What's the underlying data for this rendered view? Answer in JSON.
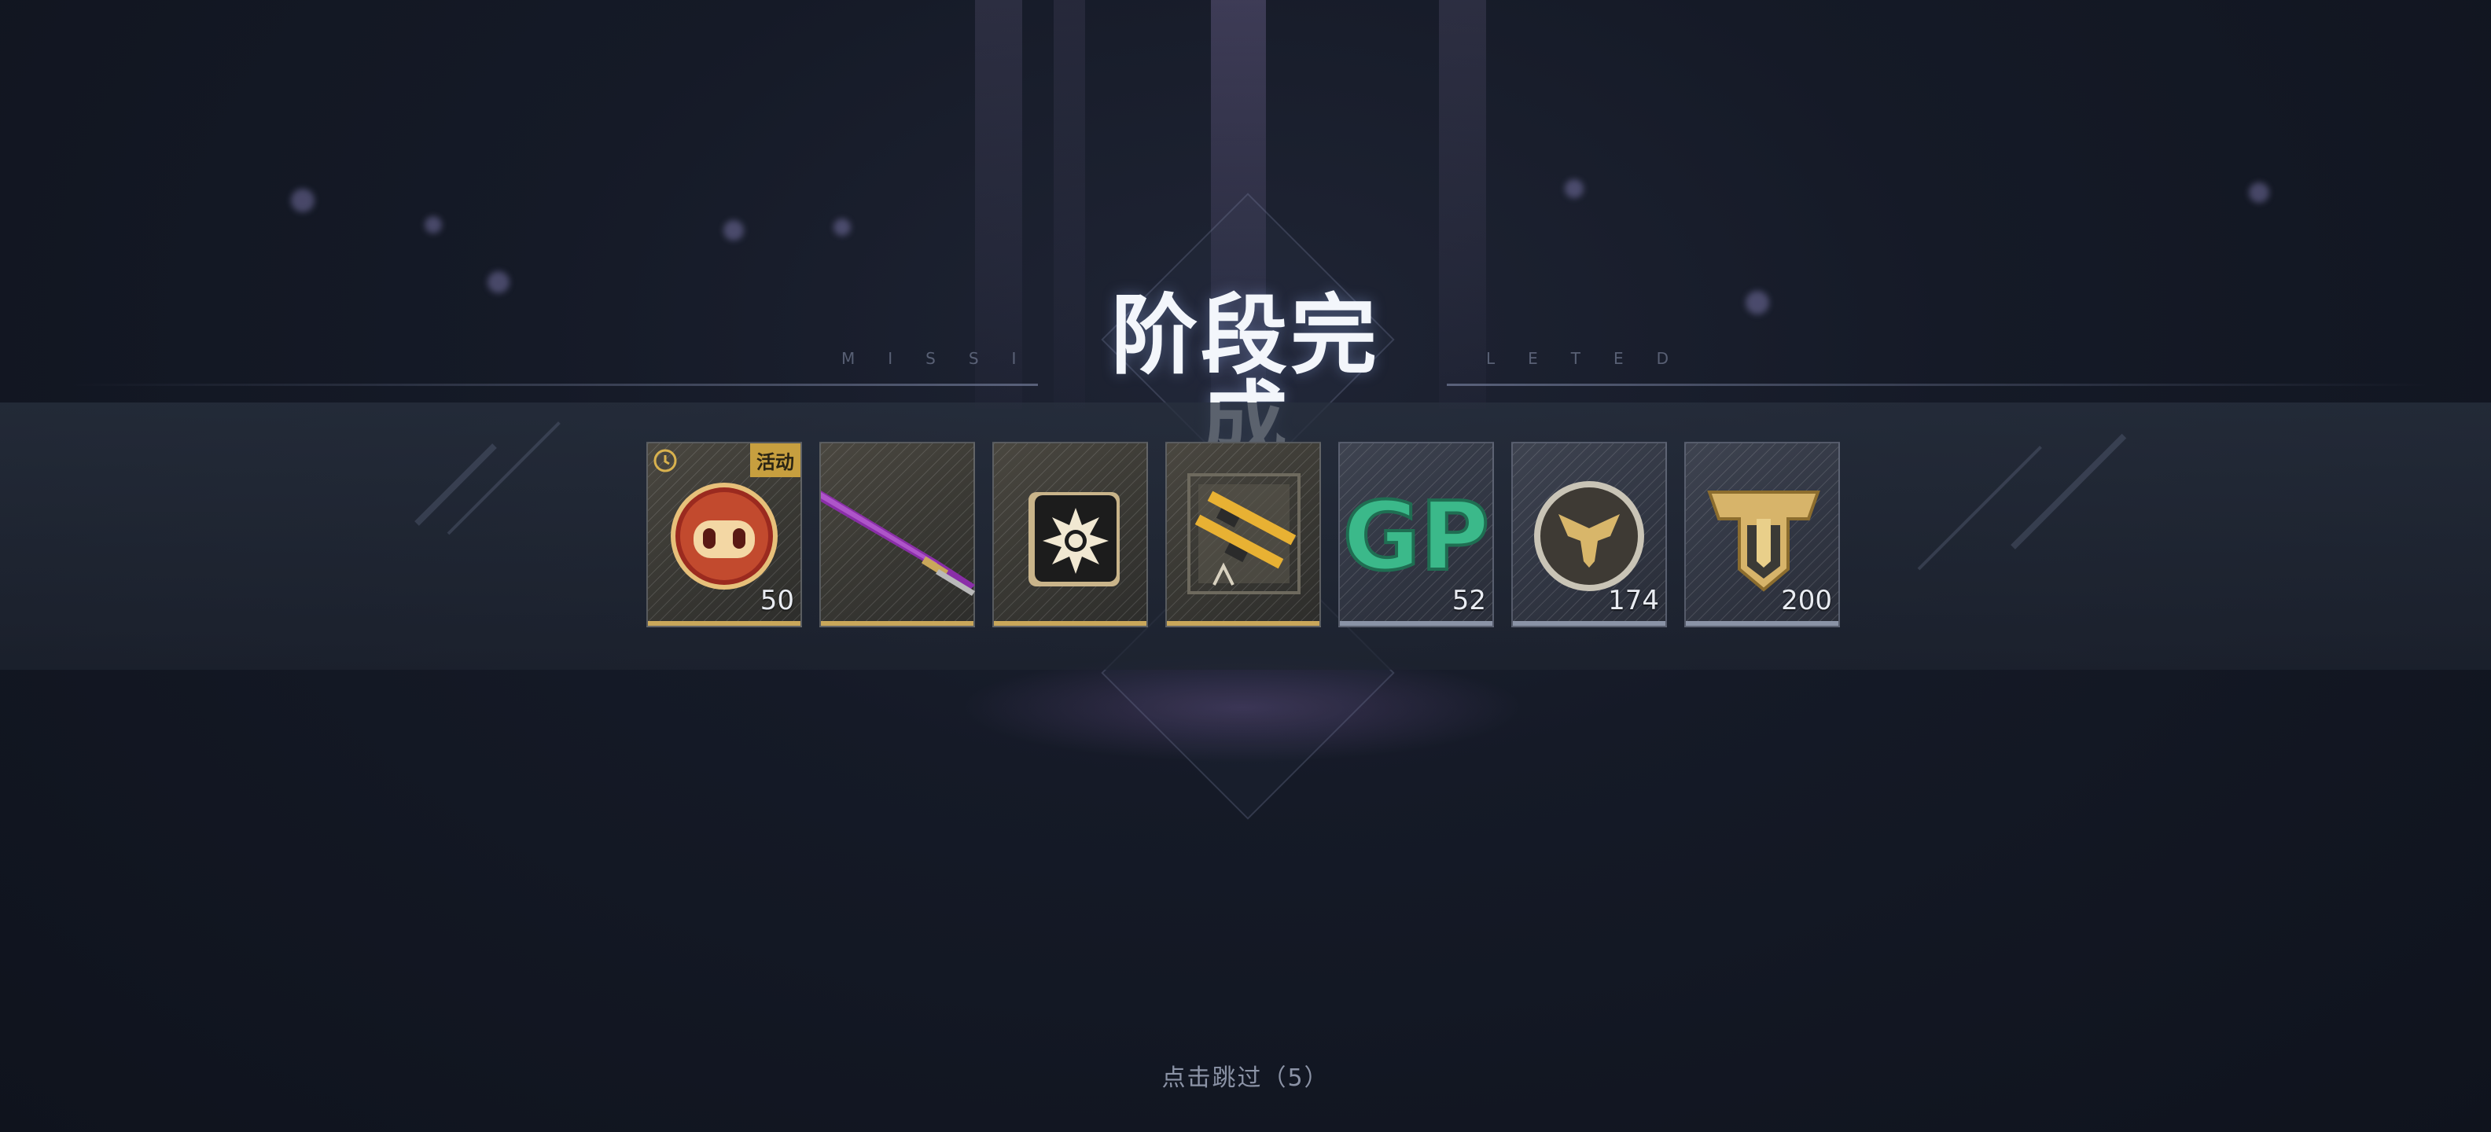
{
  "screen": {
    "title": "阶段完成",
    "subtitle_left": "MISSI",
    "subtitle_right": "LETED",
    "skip_hint": "点击跳过（5）"
  },
  "rewards": [
    {
      "name_icon": "pig-token-icon",
      "count": "50",
      "tag": "活动",
      "timed": true,
      "rarity": "gold"
    },
    {
      "name_icon": "katana-icon",
      "count": "",
      "tag": "",
      "timed": false,
      "rarity": "gold"
    },
    {
      "name_icon": "explosion-card-icon",
      "count": "",
      "tag": "",
      "timed": false,
      "rarity": "gold"
    },
    {
      "name_icon": "weapon-crate-icon",
      "count": "",
      "tag": "",
      "timed": false,
      "rarity": "gold"
    },
    {
      "name_icon": "gp-currency-icon",
      "count": "52",
      "tag": "",
      "timed": false,
      "rarity": "gray"
    },
    {
      "name_icon": "emblem-coin-icon",
      "count": "174",
      "tag": "",
      "timed": false,
      "rarity": "gray"
    },
    {
      "name_icon": "rank-badge-icon",
      "count": "200",
      "tag": "",
      "timed": false,
      "rarity": "gray"
    }
  ],
  "colors": {
    "gold_bar": "#c9a75a",
    "gray_bar": "#8a93a6",
    "tag_bg": "#c79f3f",
    "gp_green": "#3bb98a"
  }
}
